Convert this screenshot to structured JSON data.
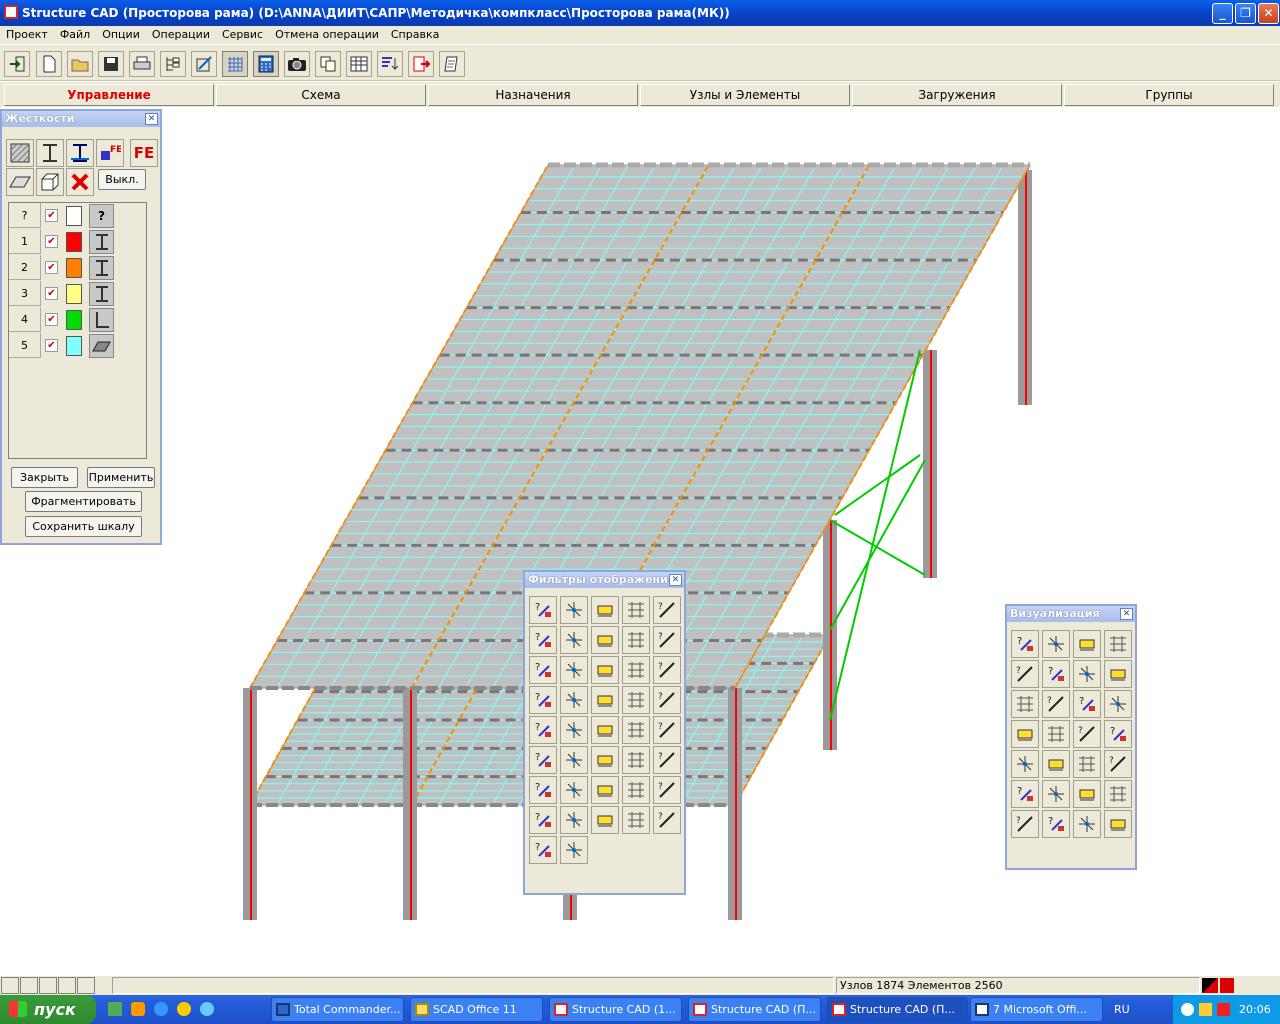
{
  "window": {
    "title": "Structure CAD (Просторова рама) (D:\\ANNA\\ДИИТ\\САПР\\Методичка\\компкласс\\Просторова рама(МК))"
  },
  "menu": [
    "Проект",
    "Файл",
    "Опции",
    "Операции",
    "Сервис",
    "Отмена операции",
    "Справка"
  ],
  "tabs": [
    "Управление",
    "Схема",
    "Назначения",
    "Узлы и Элементы",
    "Загружения",
    "Группы"
  ],
  "active_tab": "Управление",
  "stiffness_palette": {
    "title": "Жесткости",
    "off_button": "Выкл.",
    "rows": [
      {
        "num": "?",
        "color": "#ffffff",
        "icon": "?"
      },
      {
        "num": "1",
        "color": "#ff0000",
        "icon": "i-beam-icon"
      },
      {
        "num": "2",
        "color": "#ff7f00",
        "icon": "i-beam-icon"
      },
      {
        "num": "3",
        "color": "#ffff80",
        "icon": "i-beam-icon"
      },
      {
        "num": "4",
        "color": "#00dd00",
        "icon": "angle-icon"
      },
      {
        "num": "5",
        "color": "#80ffff",
        "icon": "plate-icon"
      }
    ],
    "close_label": "Закрыть",
    "apply_label": "Применить",
    "fragment_label": "Фрагментировать",
    "save_scale_label": "Сохранить шкалу",
    "fe_label": "FE"
  },
  "filters_palette": {
    "title": "Фильтры отображения"
  },
  "visual_palette": {
    "title": "Визуализация"
  },
  "status": {
    "text": "Узлов 1874 Элементов 2560"
  },
  "taskbar": {
    "start": "пуск",
    "items": [
      "Total Commander...",
      "SCAD Office 11",
      "Structure CAD (1...",
      "Structure CAD (П...",
      "Structure CAD (П...",
      "7 Microsoft Offi..."
    ],
    "lang": "RU",
    "clock": "20:06"
  },
  "colors": {
    "accent": "#e00000",
    "beam": "#ff8c00",
    "column": "#ff0000",
    "brace": "#00cc00",
    "mesh": "#80ffff",
    "slab": "#c0c0c0"
  }
}
